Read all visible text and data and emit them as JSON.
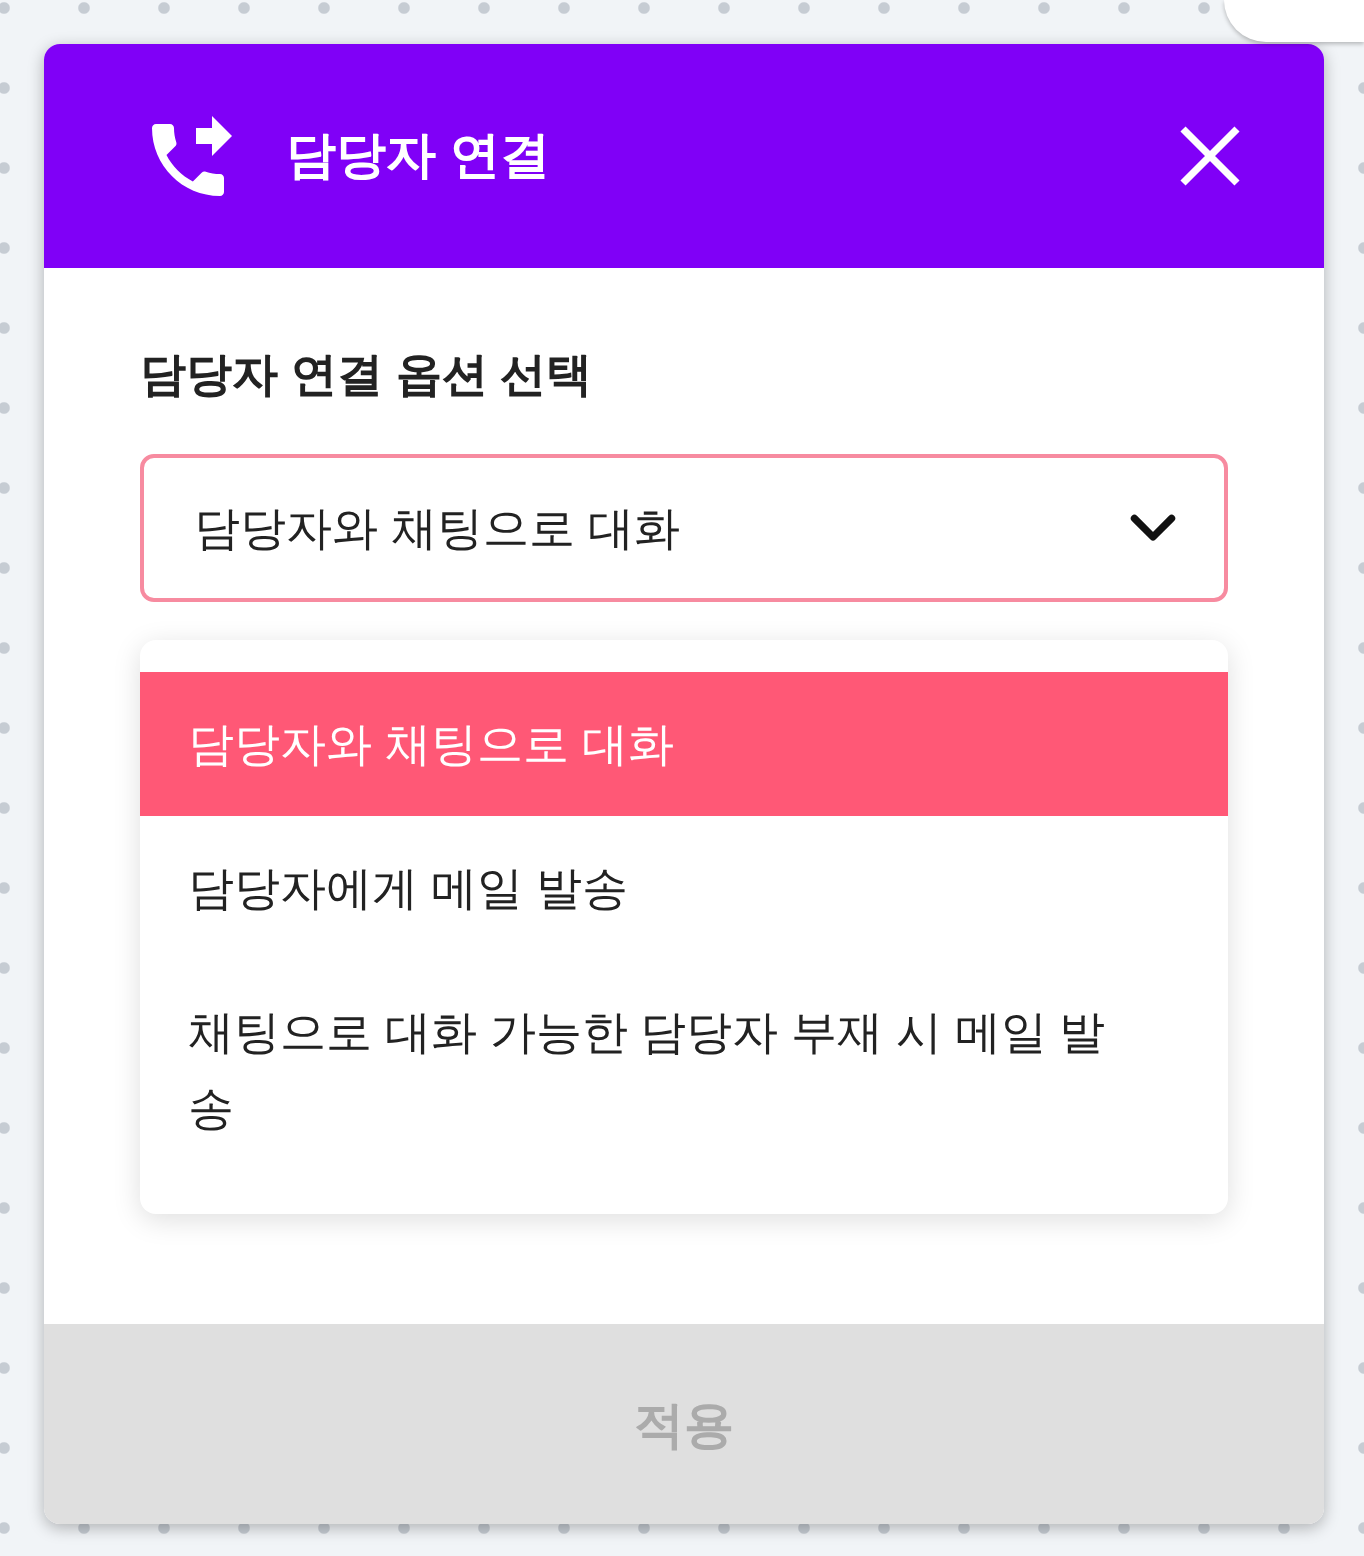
{
  "dialog": {
    "title": "담당자 연결"
  },
  "field": {
    "label": "담당자 연결 옵션 선택",
    "value": "담당자와 채팅으로 대화",
    "expanded": true,
    "options": [
      {
        "label": "담당자와 채팅으로 대화",
        "selected": true
      },
      {
        "label": "담당자에게 메일 발송",
        "selected": false
      },
      {
        "label": "채팅으로 대화 가능한 담당자 부재 시 메일 발송",
        "selected": false
      }
    ]
  },
  "apply_button": {
    "label": "적용",
    "disabled": true
  }
}
